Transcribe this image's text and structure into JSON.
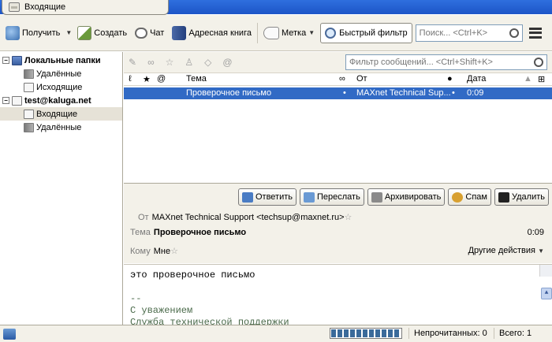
{
  "tab": {
    "label": "Входящие",
    "icon": "inbox-icon"
  },
  "toolbar": {
    "get_label": "Получить",
    "compose_label": "Создать",
    "chat_label": "Чат",
    "addressbook_label": "Адресная книга",
    "tag_label": "Метка",
    "quickfilter_label": "Быстрый фильтр",
    "search_placeholder": "Поиск... <Ctrl+K>"
  },
  "folders": {
    "local": {
      "label": "Локальные папки",
      "children": [
        "Удалённые",
        "Исходящие"
      ]
    },
    "account": {
      "label": "test@kaluga.net",
      "children": [
        "Входящие",
        "Удалённые"
      ]
    }
  },
  "list": {
    "filter_placeholder": "Фильтр сообщений... <Ctrl+Shift+K>",
    "columns": {
      "subject": "Тема",
      "from": "От",
      "date": "Дата"
    },
    "rows": [
      {
        "subject": "Проверочное письмо",
        "from": "MAXnet Technical Sup...",
        "date": "0:09"
      }
    ]
  },
  "header": {
    "actions": {
      "reply": "Ответить",
      "forward": "Переслать",
      "archive": "Архивировать",
      "spam": "Спам",
      "delete": "Удалить"
    },
    "from_label": "От",
    "from_value": "MAXnet Technical Support <techsup@maxnet.ru>",
    "subject_label": "Тема",
    "subject_value": "Проверочное письмо",
    "to_label": "Кому",
    "to_value": "Мне",
    "date": "0:09",
    "other_actions": "Другие действия"
  },
  "body": {
    "lines": [
      "это проверочное письмо",
      "",
      "--",
      "С уважением",
      "Служба технической поддержки"
    ]
  },
  "status": {
    "progress_fraction": 1.0,
    "unread": "Непрочитанных: 0",
    "total": "Всего: 1"
  },
  "colors": {
    "selection": "#316ac5",
    "chrome": "#f3f1e9",
    "titlebar": "#2f6fde"
  }
}
